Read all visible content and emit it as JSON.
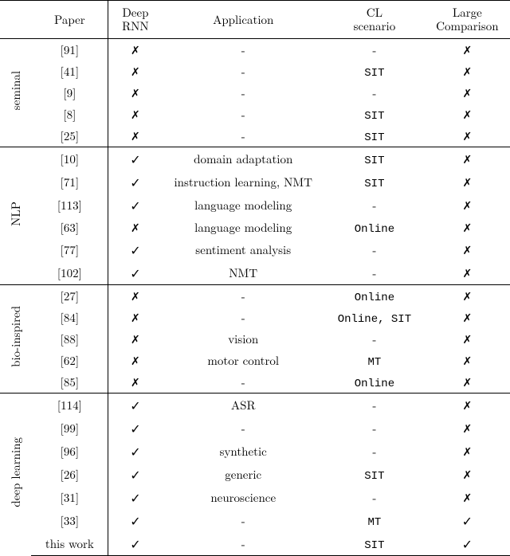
{
  "headers": {
    "paper": "Paper",
    "rnn_line1": "Deep",
    "rnn_line2": "RNN",
    "application": "Application",
    "cl_line1": "CL",
    "cl_line2": "scenario",
    "large_line1": "Large",
    "large_line2": "Comparison"
  },
  "groups": [
    {
      "name": "seminal",
      "rows": [
        {
          "paper": "[91]",
          "rnn": "✗",
          "app": "-",
          "cl": "-",
          "large": "✗"
        },
        {
          "paper": "[41]",
          "rnn": "✗",
          "app": "-",
          "cl": "SIT",
          "large": "✗"
        },
        {
          "paper": "[9]",
          "rnn": "✗",
          "app": "-",
          "cl": "-",
          "large": "✗"
        },
        {
          "paper": "[8]",
          "rnn": "✗",
          "app": "-",
          "cl": "SIT",
          "large": "✗"
        },
        {
          "paper": "[25]",
          "rnn": "✗",
          "app": "-",
          "cl": "SIT",
          "large": "✗"
        }
      ]
    },
    {
      "name": "NLP",
      "rows": [
        {
          "paper": "[10]",
          "rnn": "✓",
          "app": "domain adaptation",
          "cl": "SIT",
          "large": "✗"
        },
        {
          "paper": "[71]",
          "rnn": "✓",
          "app": "instruction learning, NMT",
          "cl": "SIT",
          "large": "✗"
        },
        {
          "paper": "[113]",
          "rnn": "✓",
          "app": "language modeling",
          "cl": "-",
          "large": "✗"
        },
        {
          "paper": "[63]",
          "rnn": "✗",
          "app": "language modeling",
          "cl": "Online",
          "large": "✗"
        },
        {
          "paper": "[77]",
          "rnn": "✓",
          "app": "sentiment analysis",
          "cl": "-",
          "large": "✗"
        },
        {
          "paper": "[102]",
          "rnn": "✓",
          "app": "NMT",
          "cl": "-",
          "large": "✗"
        }
      ]
    },
    {
      "name": "bio-inspired",
      "rows": [
        {
          "paper": "[27]",
          "rnn": "✗",
          "app": "-",
          "cl": "Online",
          "large": "✗"
        },
        {
          "paper": "[84]",
          "rnn": "✗",
          "app": "-",
          "cl": "Online, SIT",
          "large": "✗"
        },
        {
          "paper": "[88]",
          "rnn": "✗",
          "app": "vision",
          "cl": "-",
          "large": "✗"
        },
        {
          "paper": "[62]",
          "rnn": "✗",
          "app": "motor control",
          "cl": "MT",
          "large": "✗"
        },
        {
          "paper": "[85]",
          "rnn": "✗",
          "app": "-",
          "cl": "Online",
          "large": "✗"
        }
      ]
    },
    {
      "name": "deep learning",
      "rows": [
        {
          "paper": "[114]",
          "rnn": "✓",
          "app": "ASR",
          "cl": "-",
          "large": "✗"
        },
        {
          "paper": "[99]",
          "rnn": "✓",
          "app": "-",
          "cl": "-",
          "large": "✗"
        },
        {
          "paper": "[96]",
          "rnn": "✓",
          "app": "synthetic",
          "cl": "-",
          "large": "✗"
        },
        {
          "paper": "[26]",
          "rnn": "✓",
          "app": "generic",
          "cl": "SIT",
          "large": "✗"
        },
        {
          "paper": "[31]",
          "rnn": "✓",
          "app": "neuroscience",
          "cl": "-",
          "large": "✗"
        },
        {
          "paper": "[33]",
          "rnn": "✓",
          "app": "-",
          "cl": "MT",
          "large": "✓"
        },
        {
          "paper": "this work",
          "rnn": "✓",
          "app": "-",
          "cl": "SIT",
          "large": "✓"
        }
      ]
    }
  ]
}
